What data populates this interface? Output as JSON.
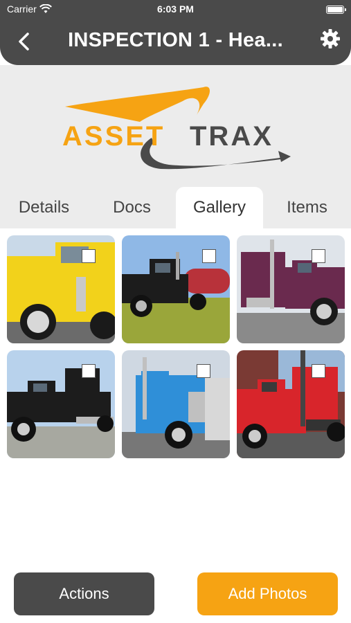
{
  "status_bar": {
    "carrier": "Carrier",
    "time": "6:03 PM"
  },
  "header": {
    "title": "INSPECTION 1 - Hea...",
    "back_icon": "chevron-left-icon",
    "settings_icon": "gear-icon"
  },
  "logo": {
    "text_left": "ASSET",
    "text_right": "TRAX",
    "accent": "#f6a313",
    "dark": "#4a4a4a"
  },
  "tabs": [
    {
      "label": "Details",
      "active": false
    },
    {
      "label": "Docs",
      "active": false
    },
    {
      "label": "Gallery",
      "active": true
    },
    {
      "label": "Items",
      "active": false
    }
  ],
  "gallery": {
    "photos": [
      {
        "truck_color": "#f2d21b",
        "checked": false
      },
      {
        "truck_color": "#1c1c1c",
        "checked": false
      },
      {
        "truck_color": "#6a2a4e",
        "checked": false
      },
      {
        "truck_color": "#1c1c1c",
        "checked": false
      },
      {
        "truck_color": "#2f8fd8",
        "checked": false
      },
      {
        "truck_color": "#d8252b",
        "checked": false
      }
    ]
  },
  "buttons": {
    "actions": "Actions",
    "add_photos": "Add Photos"
  }
}
